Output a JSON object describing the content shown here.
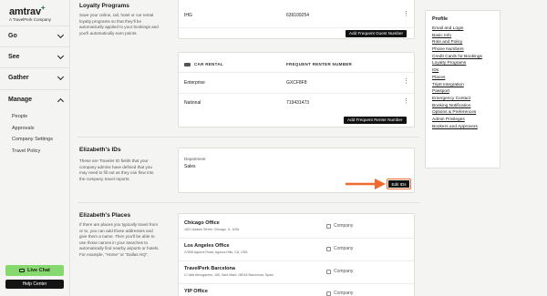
{
  "brand": {
    "name": "amtrav",
    "plus": "+",
    "tagline": "A TravelPerk Company"
  },
  "sidebar": {
    "sections": [
      {
        "label": "Go"
      },
      {
        "label": "See"
      },
      {
        "label": "Gather"
      },
      {
        "label": "Manage"
      }
    ],
    "manage_items": [
      "People",
      "Approvals",
      "Company Settings",
      "Travel Policy"
    ],
    "live_chat": "Live Chat",
    "help_center": "Help Center"
  },
  "loyalty": {
    "title": "Loyalty Programs",
    "desc": "Save your online, rail, hotel or car rental loyalty programs so that they'll be automatically applied to your bookings and you'll automatically earn points.",
    "hotel_row": {
      "name": "IHG",
      "number": "639109254"
    },
    "add_guest_btn": "Add Frequent Guest Number",
    "car": {
      "header_type": "CAR RENTAL",
      "header_number": "FREQUENT RENTER NUMBER",
      "rows": [
        {
          "name": "Enterprise",
          "number": "GXCF8F8"
        },
        {
          "name": "National",
          "number": "719431473"
        }
      ],
      "add_btn": "Add Frequent Renter Number"
    }
  },
  "ids": {
    "title": "Elizabeth's IDs",
    "desc": "These are Traveler ID fields that your company admins have defined that you may need to fill out as they can flow into the company travel reports.",
    "field_label": "Department",
    "field_value": "Sales",
    "edit_btn": "Edit IDs"
  },
  "places": {
    "title": "Elizabeth's Places",
    "desc": "If there are places you typically travel from or to, you can add those addresses and give them a name. Then you'll be able to use those names in your searches to automatically find nearby airports or hotels. For example, \"Home\" or \"Dallas HQ\".",
    "company_label": "Company",
    "items": [
      {
        "name": "Chicago Office",
        "address": "1621 Adams Street, Chicago, IL, USA"
      },
      {
        "name": "Los Angeles Office",
        "address": "27808 Agoura Road, Agoura Hills, CA, USA"
      },
      {
        "name": "TravelPerk Barcelona",
        "address": "C/ dels Almogàvers, 165, Sant Martí, 08018 Barcelona, Spain"
      },
      {
        "name": "YIP Office",
        "address": ""
      }
    ]
  },
  "profile_nav": {
    "title": "Profile",
    "items": [
      "Email and Login",
      "Basic Info",
      "Role and Policy",
      "Phone Numbers",
      "Credit Cards for Bookings",
      "Loyalty Programs",
      "IDs",
      "Places",
      "TripIt Integration",
      "Passport",
      "Emergency Contact",
      "Booking Notification",
      "Options & Preferences",
      "Admin Privileges",
      "Bookers and Approvers"
    ]
  },
  "colors": {
    "accent_orange": "#f26b2e",
    "live_chat_green": "#86d96e",
    "brand_green": "#1c6b4b"
  }
}
